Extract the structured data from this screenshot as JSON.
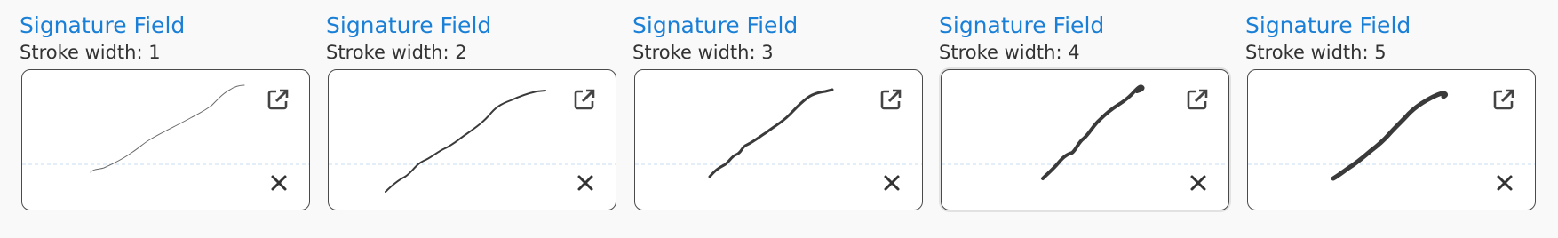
{
  "fields": [
    {
      "title": "Signature Field",
      "subtitle": "Stroke width: 1",
      "stroke_width": 1,
      "focused": false
    },
    {
      "title": "Signature Field",
      "subtitle": "Stroke width: 2",
      "stroke_width": 2,
      "focused": false
    },
    {
      "title": "Signature Field",
      "subtitle": "Stroke width: 3",
      "stroke_width": 3,
      "focused": false
    },
    {
      "title": "Signature Field",
      "subtitle": "Stroke width: 4",
      "stroke_width": 4,
      "focused": true
    },
    {
      "title": "Signature Field",
      "subtitle": "Stroke width: 5",
      "stroke_width": 5,
      "focused": false
    }
  ],
  "icons": {
    "expand": "expand-icon",
    "clear": "close-icon"
  },
  "colors": {
    "title": "#1a7fd6",
    "stroke": "#3a3a3a",
    "baseline": "#c9dcf2"
  }
}
